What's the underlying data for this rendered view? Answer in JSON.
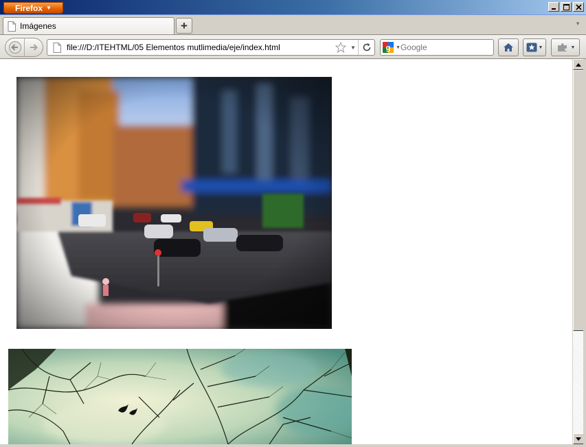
{
  "window": {
    "app_menu_label": "Firefox"
  },
  "tabs": [
    {
      "label": "Imágenes",
      "icon": "page-icon"
    }
  ],
  "navbar": {
    "url": "file:///D:/ITEHTML/05 Elementos mutlimedia/eje/index.html",
    "search_placeholder": "Google"
  },
  "content": {
    "images": [
      {
        "name": "city-street-tilt-shift-photo"
      },
      {
        "name": "tree-branches-sky-photo"
      }
    ]
  },
  "colors": {
    "firefox_button": "#e66000",
    "title_bar": "#0a246a",
    "page_background": "#ffffff"
  }
}
